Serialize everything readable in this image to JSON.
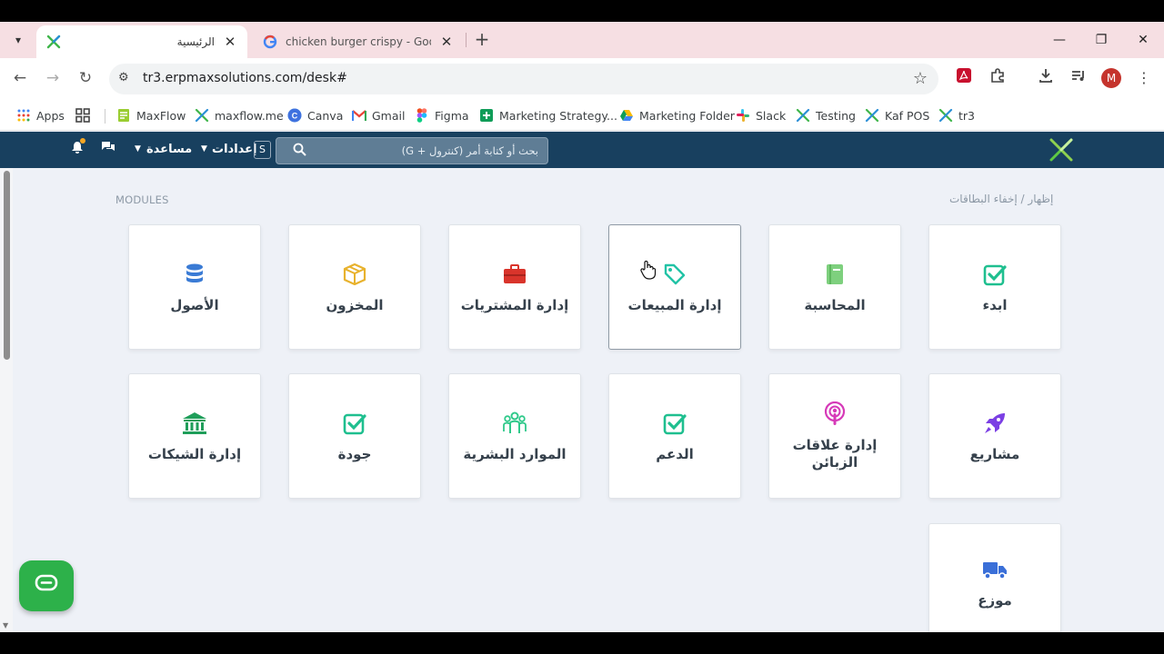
{
  "browser": {
    "tabs": [
      {
        "title": "الرئيسية",
        "active": true
      },
      {
        "title": "chicken burger crispy - Google",
        "active": false
      }
    ],
    "url": "tr3.erpmaxsolutions.com/desk#",
    "profile_initial": "M",
    "bookmarks": [
      {
        "label": "Apps",
        "icon": "apps-grid-icon"
      },
      {
        "label": "",
        "icon": "tab-groups-icon"
      },
      {
        "label": "MaxFlow",
        "icon": "maxflow-icon"
      },
      {
        "label": "maxflow.me",
        "icon": "x-logo-icon"
      },
      {
        "label": "Canva",
        "icon": "canva-icon"
      },
      {
        "label": "Gmail",
        "icon": "gmail-icon"
      },
      {
        "label": "Figma",
        "icon": "figma-icon"
      },
      {
        "label": "Marketing Strategy...",
        "icon": "sheets-icon"
      },
      {
        "label": "Marketing Folder",
        "icon": "drive-icon"
      },
      {
        "label": "Slack",
        "icon": "slack-icon"
      },
      {
        "label": "Testing",
        "icon": "x-logo-icon"
      },
      {
        "label": "Kaf POS",
        "icon": "x-logo-icon"
      },
      {
        "label": "tr3",
        "icon": "x-logo-icon"
      }
    ]
  },
  "appnav": {
    "help_label": "مساعدة",
    "settings_label": "إعدادات",
    "settings_badge": "S",
    "search_placeholder": "بحث أو كتابة أمر (كنترول + G)"
  },
  "content": {
    "modules_label": "MODULES",
    "toggle_cards_label": "إظهار / إخفاء البطاقات",
    "cards": [
      {
        "label": "ابدء",
        "icon": "checkbox-icon",
        "color": "#1fbf8f"
      },
      {
        "label": "المحاسبة",
        "icon": "book-icon",
        "color": "#7ed07e"
      },
      {
        "label": "إدارة المبيعات",
        "icon": "tag-icon",
        "color": "#22c3a6"
      },
      {
        "label": "إدارة المشتريات",
        "icon": "briefcase-icon",
        "color": "#d9342b"
      },
      {
        "label": "المخزون",
        "icon": "box-icon",
        "color": "#e8b22d"
      },
      {
        "label": "الأصول",
        "icon": "database-icon",
        "color": "#3a7bd5"
      },
      {
        "label": "مشاريع",
        "icon": "rocket-icon",
        "color": "#7b3fe4"
      },
      {
        "label": "إدارة علاقات الزبائن",
        "icon": "podcast-icon",
        "color": "#d63ab8"
      },
      {
        "label": "الدعم",
        "icon": "checkbox-icon",
        "color": "#1fbf8f"
      },
      {
        "label": "الموارد البشرية",
        "icon": "people-icon",
        "color": "#2fc98a"
      },
      {
        "label": "جودة",
        "icon": "checkbox-icon",
        "color": "#1fbf8f"
      },
      {
        "label": "إدارة الشيكات",
        "icon": "bank-icon",
        "color": "#1f9e5a"
      },
      {
        "label": "موزع",
        "icon": "truck-icon",
        "color": "#3a6fd8"
      }
    ]
  }
}
